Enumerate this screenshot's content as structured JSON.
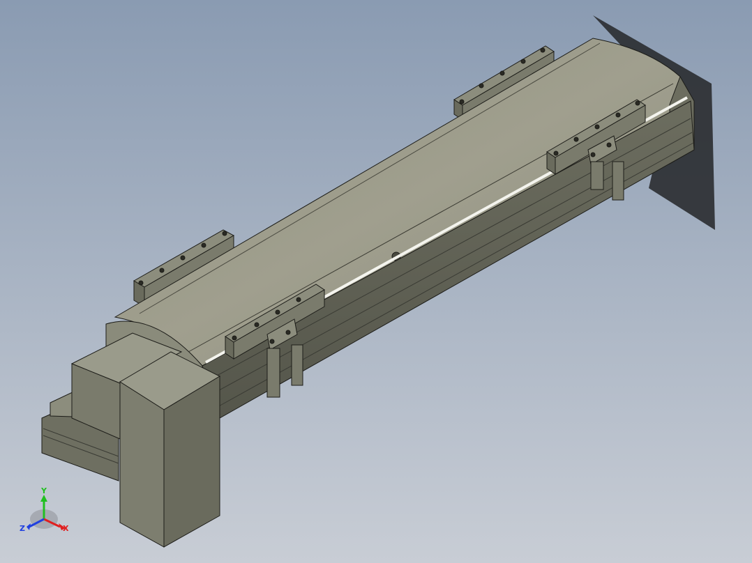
{
  "viewport": {
    "background_top": "#8a9bb2",
    "background_bottom": "#c8cdd5",
    "model_body_color": "#7a7b6c",
    "model_light_color": "#9b9c8c",
    "model_dark_color": "#5e5f52",
    "edge_color": "#1c1c18",
    "shadow_color": "#2a2c30"
  },
  "triad": {
    "x_label": "X",
    "y_label": "Y",
    "z_label": "Z",
    "x_color": "#e02020",
    "y_color": "#20c020",
    "z_color": "#2040e0"
  }
}
